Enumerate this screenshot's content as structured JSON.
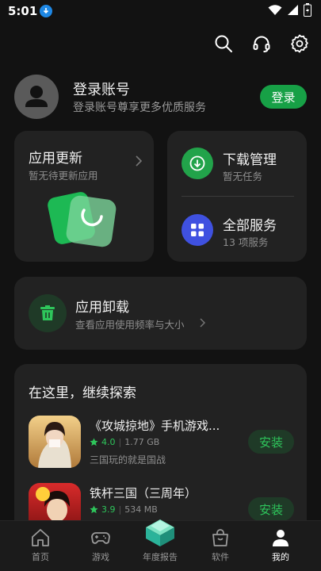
{
  "status": {
    "time": "5:01"
  },
  "account": {
    "title": "登录账号",
    "subtitle": "登录账号尊享更多优质服务",
    "login_label": "登录"
  },
  "update_card": {
    "title": "应用更新",
    "subtitle": "暂无待更新应用"
  },
  "download_card": {
    "title": "下载管理",
    "subtitle": "暂无任务"
  },
  "services_card": {
    "title": "全部服务",
    "subtitle": "13 项服务"
  },
  "uninstall_card": {
    "title": "应用卸载",
    "subtitle": "查看应用使用频率与大小"
  },
  "explore": {
    "title": "在这里，继续探索",
    "apps": [
      {
        "name": "《攻城掠地》手机游戏...",
        "rating": "4.0",
        "size": "1.77 GB",
        "desc": "三国玩的就是国战",
        "action": "安装"
      },
      {
        "name": "铁杆三国（三周年）",
        "rating": "3.9",
        "size": "534 MB",
        "desc": "",
        "action": "安装"
      }
    ]
  },
  "nav": [
    {
      "label": "首页",
      "icon": "home-icon"
    },
    {
      "label": "游戏",
      "icon": "gamepad-icon"
    },
    {
      "label": "年度报告",
      "icon": "annual-report-icon"
    },
    {
      "label": "软件",
      "icon": "shopping-bag-icon"
    },
    {
      "label": "我的",
      "icon": "person-icon"
    }
  ],
  "colors": {
    "accent": "#17a046",
    "background": "#121212",
    "card": "#222222",
    "download": "#22a34a",
    "services": "#3f51e0"
  }
}
